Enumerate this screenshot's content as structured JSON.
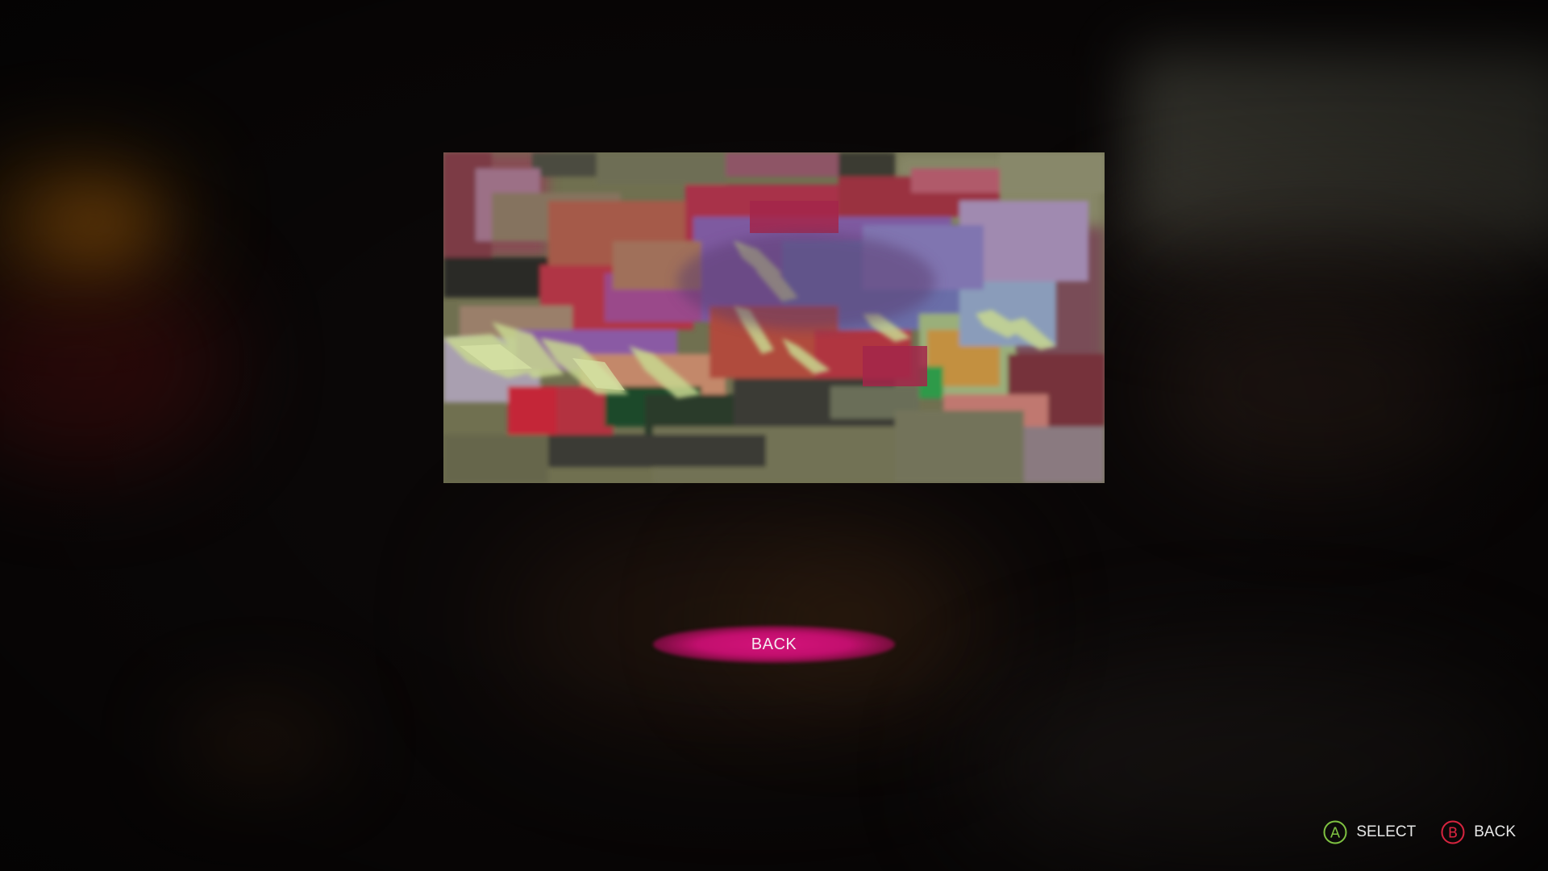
{
  "menu": {
    "back_button_label": "BACK"
  },
  "footer": {
    "hints": [
      {
        "button": "A",
        "label": "SELECT",
        "icon": "a-button-icon",
        "color": "#7fc241"
      },
      {
        "button": "B",
        "label": "BACK",
        "icon": "b-button-icon",
        "color": "#d8243f"
      }
    ]
  },
  "colors": {
    "highlight": "#c8106f",
    "background": "#0a0707"
  }
}
